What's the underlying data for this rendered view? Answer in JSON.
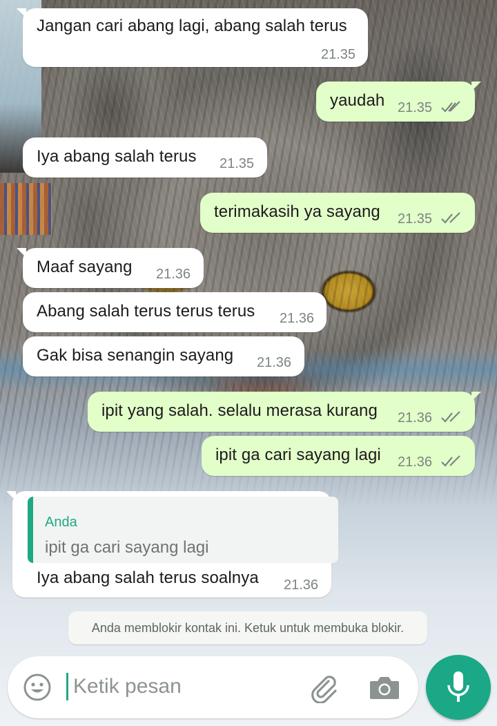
{
  "messages": [
    {
      "dir": "in",
      "text": "Jangan cari abang lagi, abang salah terus",
      "time": "21.35"
    },
    {
      "dir": "out",
      "text": "yaudah",
      "time": "21.35",
      "status": "read"
    },
    {
      "dir": "in",
      "text": "Iya abang salah terus",
      "time": "21.35"
    },
    {
      "dir": "out",
      "text": "terimakasih ya sayang",
      "time": "21.35",
      "status": "read"
    },
    {
      "dir": "in",
      "text": "Maaf sayang",
      "time": "21.36"
    },
    {
      "dir": "in",
      "text": "Abang salah terus terus terus",
      "time": "21.36"
    },
    {
      "dir": "in",
      "text": "Gak bisa senangin sayang",
      "time": "21.36"
    },
    {
      "dir": "out",
      "text": "ipit yang salah. selalu merasa kurang",
      "time": "21.36",
      "status": "read"
    },
    {
      "dir": "out",
      "text": "ipit ga cari sayang lagi",
      "time": "21.36",
      "status": "read"
    },
    {
      "dir": "in",
      "text": "Iya abang salah terus soalnya",
      "time": "21.36",
      "quote": {
        "author": "Anda",
        "text": "ipit ga cari sayang lagi"
      }
    }
  ],
  "system_notice": "Anda memblokir kontak ini. Ketuk untuk membuka blokir.",
  "composer": {
    "placeholder": "Ketik pesan",
    "icons": [
      "emoji-icon",
      "paperclip-icon",
      "camera-icon",
      "mic-icon"
    ]
  },
  "colors": {
    "incoming_bubble": "#ffffff",
    "outgoing_bubble": "#e2fec9",
    "accent": "#1aa886",
    "timestamp": "#7c8481",
    "read_ticks": "#7c8481"
  }
}
